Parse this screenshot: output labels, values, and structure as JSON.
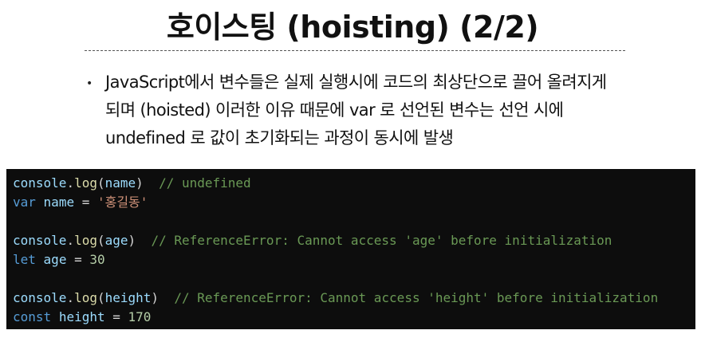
{
  "title": "호이스팅 (hoisting) (2/2)",
  "bullet": {
    "marker": "•",
    "lines": [
      "JavaScript에서 변수들은 실제 실행시에 코드의 최상단으로 끌어 올려지게",
      "되며 (hoisted) 이러한 이유 때문에 var 로 선언된 변수는 선언 시에",
      "undefined 로 값이 초기화되는 과정이 동시에 발생"
    ]
  },
  "code": {
    "lines": [
      [
        {
          "t": "console",
          "c": "obj"
        },
        {
          "t": ".",
          "c": "punc"
        },
        {
          "t": "log",
          "c": "fn"
        },
        {
          "t": "(",
          "c": "punc"
        },
        {
          "t": "name",
          "c": "var"
        },
        {
          "t": ")",
          "c": "punc"
        },
        {
          "t": "  // undefined",
          "c": "com"
        }
      ],
      [
        {
          "t": "var",
          "c": "kw"
        },
        {
          "t": " ",
          "c": "punc"
        },
        {
          "t": "name",
          "c": "var"
        },
        {
          "t": " = ",
          "c": "op"
        },
        {
          "t": "'홍길동'",
          "c": "str"
        }
      ],
      [],
      [
        {
          "t": "console",
          "c": "obj"
        },
        {
          "t": ".",
          "c": "punc"
        },
        {
          "t": "log",
          "c": "fn"
        },
        {
          "t": "(",
          "c": "punc"
        },
        {
          "t": "age",
          "c": "var"
        },
        {
          "t": ")",
          "c": "punc"
        },
        {
          "t": "  // ReferenceError: Cannot access 'age' before initialization",
          "c": "com"
        }
      ],
      [
        {
          "t": "let",
          "c": "kw"
        },
        {
          "t": " ",
          "c": "punc"
        },
        {
          "t": "age",
          "c": "var"
        },
        {
          "t": " = ",
          "c": "op"
        },
        {
          "t": "30",
          "c": "num"
        }
      ],
      [],
      [
        {
          "t": "console",
          "c": "obj"
        },
        {
          "t": ".",
          "c": "punc"
        },
        {
          "t": "log",
          "c": "fn"
        },
        {
          "t": "(",
          "c": "punc"
        },
        {
          "t": "height",
          "c": "var"
        },
        {
          "t": ")",
          "c": "punc"
        },
        {
          "t": "  // ReferenceError: Cannot access 'height' before initialization",
          "c": "com"
        }
      ],
      [
        {
          "t": "const",
          "c": "kw"
        },
        {
          "t": " ",
          "c": "punc"
        },
        {
          "t": "height",
          "c": "var"
        },
        {
          "t": " = ",
          "c": "op"
        },
        {
          "t": "170",
          "c": "num"
        }
      ]
    ]
  }
}
